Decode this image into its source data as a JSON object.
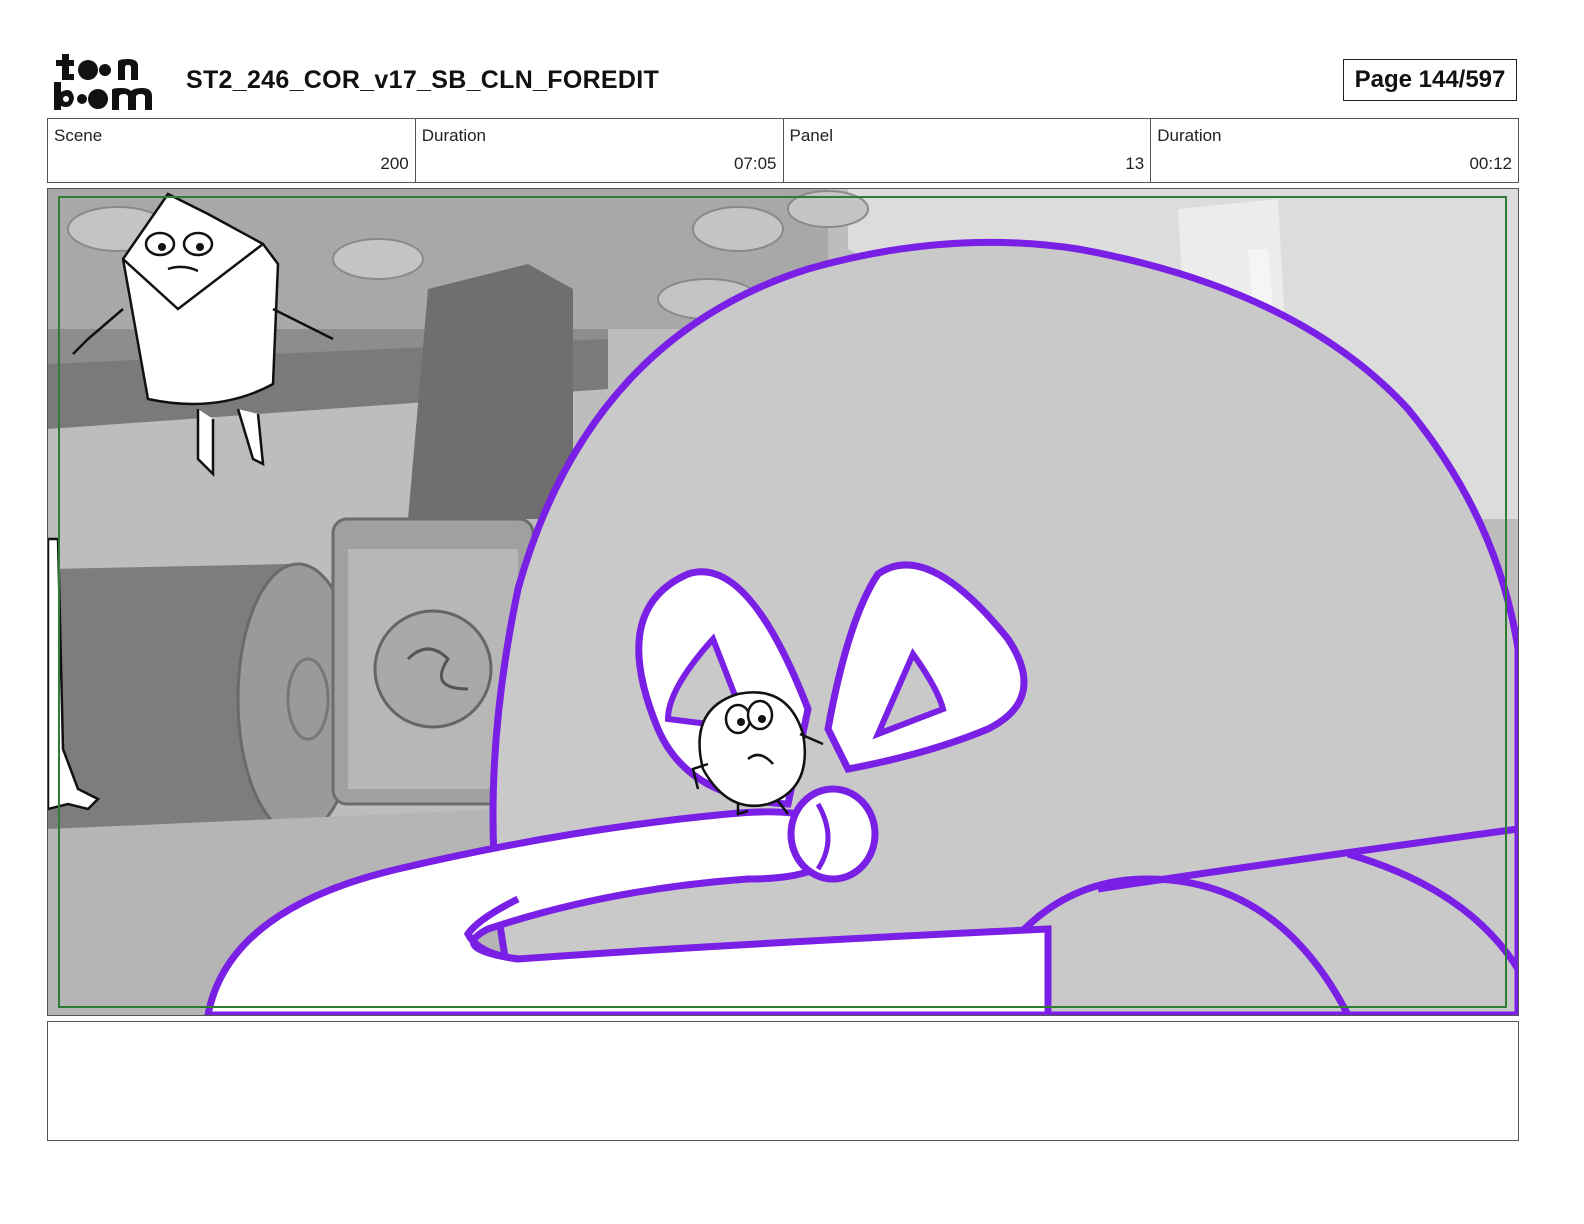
{
  "header": {
    "logo_text": "toon boom",
    "title": "ST2_246_COR_v17_SB_CLN_FOREDIT",
    "page_label": "Page 144/597"
  },
  "info": [
    {
      "label": "Scene",
      "value": "200"
    },
    {
      "label": "Duration",
      "value": "07:05"
    },
    {
      "label": "Panel",
      "value": "13"
    },
    {
      "label": "Duration",
      "value": "00:12"
    }
  ],
  "panel": {
    "image_description_icon": "storyboard-panel-image",
    "safe_frame_color": "#2e7d32",
    "bow_color": "#7a1fe6"
  },
  "notes": {
    "text": ""
  }
}
